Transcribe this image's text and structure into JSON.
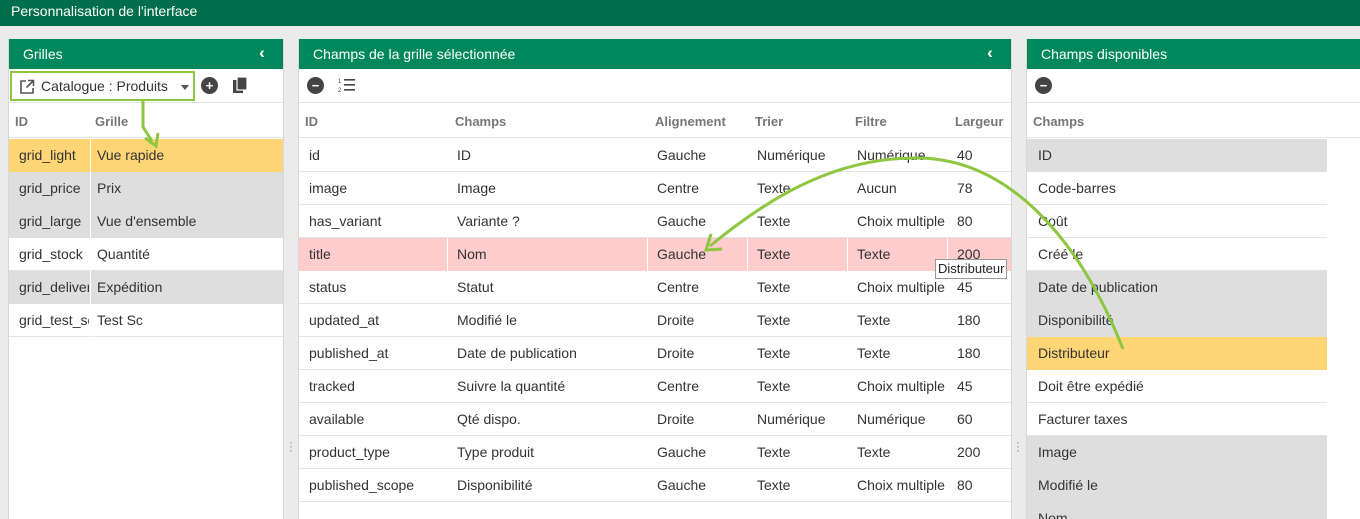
{
  "window": {
    "title": "Personnalisation de l'interface"
  },
  "left_panel": {
    "title": "Grilles",
    "grid_select": "Catalogue : Produits",
    "headers": [
      "ID",
      "Grille"
    ],
    "rows": [
      {
        "id": "grid_light",
        "name": "Vue rapide",
        "state": "selected"
      },
      {
        "id": "grid_price",
        "name": "Prix",
        "state": "gray"
      },
      {
        "id": "grid_large",
        "name": "Vue d'ensemble",
        "state": "gray"
      },
      {
        "id": "grid_stock",
        "name": "Quantité",
        "state": "normal"
      },
      {
        "id": "grid_deliver",
        "name": "Expédition",
        "state": "gray"
      },
      {
        "id": "grid_test_sc",
        "name": "Test Sc",
        "state": "normal"
      }
    ]
  },
  "middle_panel": {
    "title": "Champs de la grille sélectionnée",
    "headers": [
      "ID",
      "Champs",
      "Alignement",
      "Trier",
      "Filtre",
      "Largeur"
    ],
    "rows": [
      {
        "cells": [
          "id",
          "ID",
          "Gauche",
          "Numérique",
          "Numérique",
          "40"
        ],
        "state": "normal"
      },
      {
        "cells": [
          "image",
          "Image",
          "Centre",
          "Texte",
          "Aucun",
          "78"
        ],
        "state": "normal"
      },
      {
        "cells": [
          "has_variant",
          "Variante ?",
          "Gauche",
          "Texte",
          "Choix multiple",
          "80"
        ],
        "state": "normal"
      },
      {
        "cells": [
          "title",
          "Nom",
          "Gauche",
          "Texte",
          "Texte",
          "200"
        ],
        "state": "highlight"
      },
      {
        "cells": [
          "status",
          "Statut",
          "Centre",
          "Texte",
          "Choix multiple",
          "45"
        ],
        "state": "normal"
      },
      {
        "cells": [
          "updated_at",
          "Modifié le",
          "Droite",
          "Texte",
          "Texte",
          "180"
        ],
        "state": "normal"
      },
      {
        "cells": [
          "published_at",
          "Date de publication",
          "Droite",
          "Texte",
          "Texte",
          "180"
        ],
        "state": "normal"
      },
      {
        "cells": [
          "tracked",
          "Suivre la quantité",
          "Centre",
          "Texte",
          "Choix multiple",
          "45"
        ],
        "state": "normal"
      },
      {
        "cells": [
          "available",
          "Qté dispo.",
          "Droite",
          "Numérique",
          "Numérique",
          "60"
        ],
        "state": "normal"
      },
      {
        "cells": [
          "product_type",
          "Type produit",
          "Gauche",
          "Texte",
          "Texte",
          "200"
        ],
        "state": "normal"
      },
      {
        "cells": [
          "published_scope",
          "Disponibilité",
          "Gauche",
          "Texte",
          "Choix multiple",
          "80"
        ],
        "state": "normal"
      }
    ]
  },
  "right_panel": {
    "title": "Champs disponibles",
    "header": "Champs",
    "rows": [
      {
        "name": "ID",
        "state": "gray"
      },
      {
        "name": "Code-barres",
        "state": "normal"
      },
      {
        "name": "Coût",
        "state": "normal"
      },
      {
        "name": "Créé le",
        "state": "normal"
      },
      {
        "name": "Date de publication",
        "state": "gray"
      },
      {
        "name": "Disponibilité",
        "state": "gray"
      },
      {
        "name": "Distributeur",
        "state": "selected"
      },
      {
        "name": "Doit être expédié",
        "state": "normal"
      },
      {
        "name": "Facturer taxes",
        "state": "normal"
      },
      {
        "name": "Image",
        "state": "gray"
      },
      {
        "name": "Modifié le",
        "state": "gray"
      },
      {
        "name": "Nom",
        "state": "gray"
      }
    ]
  },
  "drag_tooltip": "Distributeur",
  "colors": {
    "header_green": "#00885c",
    "topbar_green": "#006e4a",
    "annotation_green": "#8dc63f",
    "selected_row": "#fed575",
    "highlight_row": "#fdcccc",
    "gray_row": "#dedede"
  },
  "icons": {
    "open": "external-link-icon",
    "add": "plus-circle-icon",
    "copy": "copy-icon",
    "remove": "minus-circle-icon",
    "order": "list-order-icon",
    "collapse": "chevron-left-icon",
    "dropdown": "caret-down-icon"
  }
}
